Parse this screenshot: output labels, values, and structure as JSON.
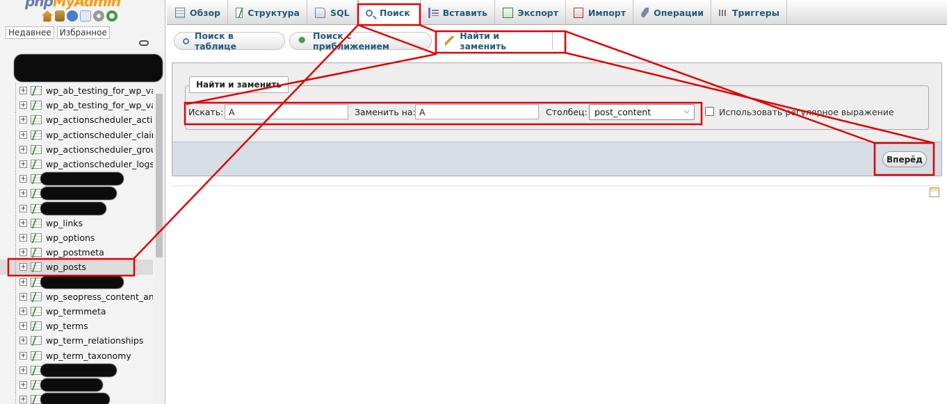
{
  "logo": {
    "text_visible": "php",
    "text_amp": "MyAdmin"
  },
  "nav": {
    "buttons": [
      "Недавнее",
      "Избранное"
    ],
    "tables": [
      {
        "label": "wp_ab_testing_for_wp_vari",
        "redacted": false
      },
      {
        "label": "wp_ab_testing_for_wp_vari",
        "redacted": false
      },
      {
        "label": "wp_actionscheduler_action",
        "redacted": false
      },
      {
        "label": "wp_actionscheduler_claim",
        "redacted": false
      },
      {
        "label": "wp_actionscheduler_group",
        "redacted": false
      },
      {
        "label": "wp_actionscheduler_logs",
        "redacted": false
      },
      {
        "label": "",
        "redacted": true
      },
      {
        "label": "",
        "redacted": true
      },
      {
        "label": "",
        "redacted": true
      },
      {
        "label": "wp_links",
        "redacted": false
      },
      {
        "label": "wp_options",
        "redacted": false
      },
      {
        "label": "wp_postmeta",
        "redacted": false
      },
      {
        "label": "wp_posts",
        "redacted": false,
        "selected": true
      },
      {
        "label": "",
        "redacted": true
      },
      {
        "label": "wp_seopress_content_anal",
        "redacted": false
      },
      {
        "label": "wp_termmeta",
        "redacted": false
      },
      {
        "label": "wp_terms",
        "redacted": false
      },
      {
        "label": "wp_term_relationships",
        "redacted": false
      },
      {
        "label": "wp_term_taxonomy",
        "redacted": false
      },
      {
        "label": "",
        "redacted": true
      },
      {
        "label": "",
        "redacted": true
      },
      {
        "label": "",
        "redacted": true
      }
    ]
  },
  "tabs": [
    {
      "label": "Обзор",
      "icon": "browse-icon"
    },
    {
      "label": "Структура",
      "icon": "structure-icon"
    },
    {
      "label": "SQL",
      "icon": "sql-icon"
    },
    {
      "label": "Поиск",
      "icon": "search-icon",
      "active": true
    },
    {
      "label": "Вставить",
      "icon": "insert-icon"
    },
    {
      "label": "Экспорт",
      "icon": "export-icon"
    },
    {
      "label": "Импорт",
      "icon": "import-icon"
    },
    {
      "label": "Операции",
      "icon": "operations-icon"
    },
    {
      "label": "Триггеры",
      "icon": "triggers-icon"
    }
  ],
  "subtabs": [
    {
      "label": "Поиск в таблице",
      "icon": "table-search-icon"
    },
    {
      "label": "Поиск с приближением",
      "icon": "zoom-search-icon"
    },
    {
      "label": "Найти и заменить",
      "icon": "find-replace-icon",
      "active": true
    }
  ],
  "form": {
    "legend": "Найти и заменить",
    "find_label": "Искать:",
    "find_value": "A",
    "replace_label": "Заменить на:",
    "replace_value": "A",
    "column_label": "Столбец:",
    "column_value": "post_content",
    "regex_label": "Использовать регулярное выражение",
    "regex_checked": false,
    "submit_label": "Вперёд"
  },
  "colors": {
    "tab_text": "#235a81",
    "annotation": "#e00000",
    "footer_bar": "#d5dde5"
  }
}
